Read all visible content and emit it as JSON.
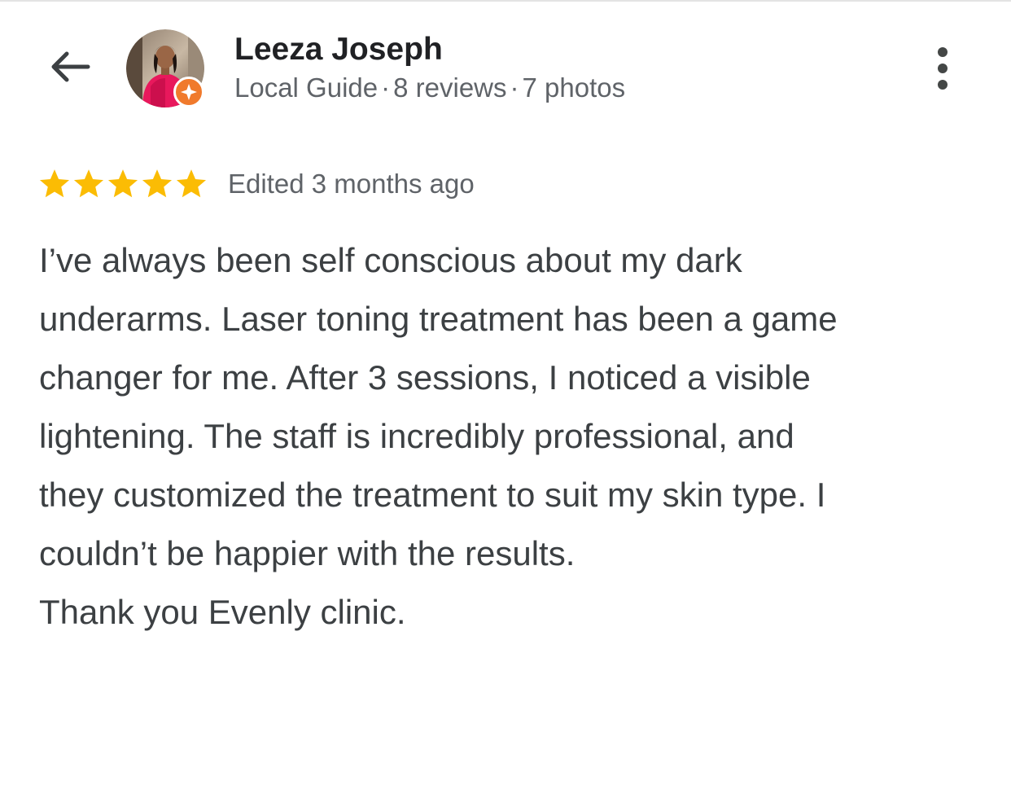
{
  "header": {
    "back_icon": "arrow-left-icon",
    "reviewer_name": "Leeza Joseph",
    "reviewer_level": "Local Guide",
    "review_count": "8 reviews",
    "photo_count": "7 photos",
    "separator": "·",
    "more_icon": "more-vertical-icon"
  },
  "avatar": {
    "badge_icon": "local-guide-star-icon",
    "badge_color": "#f07a2c"
  },
  "rating": {
    "stars": 5,
    "max": 5,
    "star_color": "#fbbc04",
    "edited_label": "Edited 3 months ago"
  },
  "review": {
    "lines": [
      "I’ve always been self conscious about my dark",
      "underarms. Laser toning treatment has been a game",
      "changer for me. After 3 sessions, I noticed a visible",
      "lightening. The staff is incredibly professional, and",
      "they customized the treatment to suit my skin type. I",
      "couldn’t be happier with the results."
    ],
    "closing": "Thank you Evenly clinic."
  }
}
